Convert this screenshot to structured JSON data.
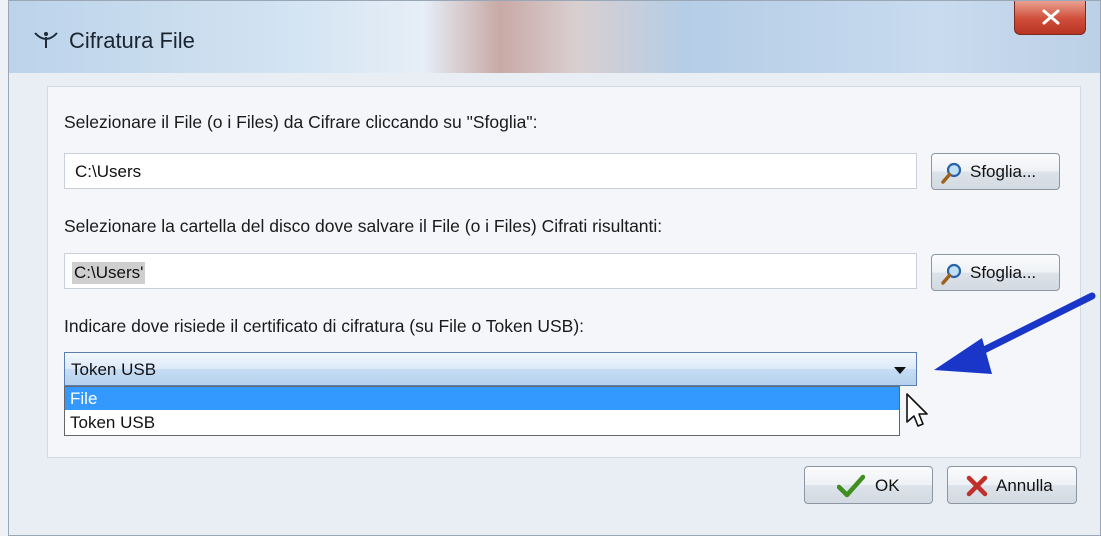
{
  "window": {
    "title": "Cifratura File"
  },
  "source": {
    "label": "Selezionare il File (o i Files) da Cifrare cliccando su \"Sfoglia\":",
    "path_value": "C:\\Users",
    "browse_label": "Sfoglia..."
  },
  "destination": {
    "label": "Selezionare la cartella del disco dove salvare il File (o i Files) Cifrati risultanti:",
    "path_value": "C:\\Users'",
    "browse_label": "Sfoglia..."
  },
  "certificate": {
    "label": "Indicare dove risiede il certificato di cifratura (su File o Token USB):",
    "selected": "Token USB",
    "options": [
      "File",
      "Token USB"
    ],
    "highlighted_option": "File"
  },
  "footer": {
    "ok_label": "OK",
    "cancel_label": "Annulla"
  },
  "colors": {
    "highlight": "#3399ff",
    "annotation_arrow": "#1a36c8",
    "close_button": "#cf4d39"
  }
}
